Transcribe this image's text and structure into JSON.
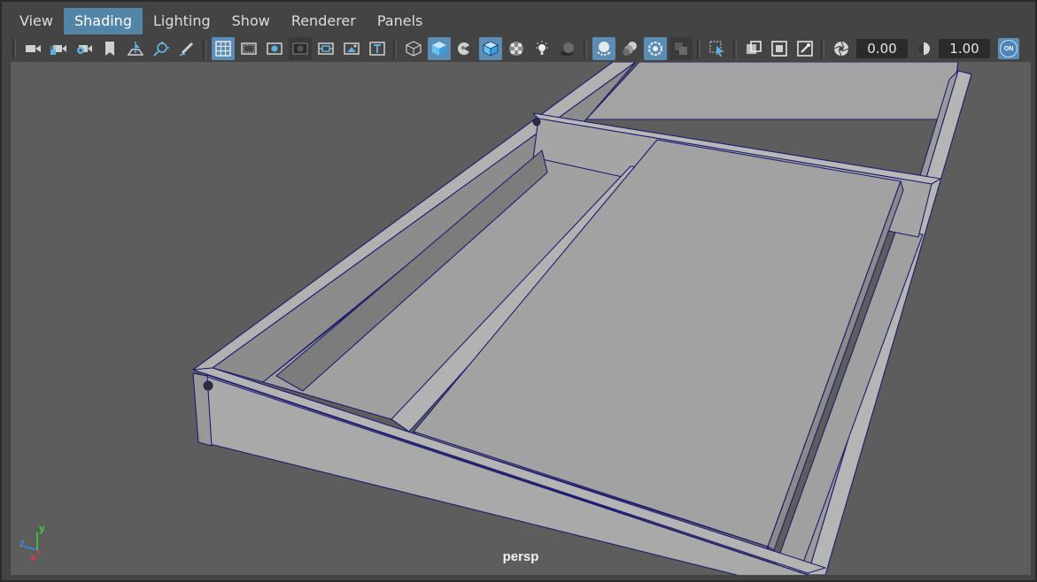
{
  "menu": {
    "items": [
      "View",
      "Shading",
      "Lighting",
      "Show",
      "Renderer",
      "Panels"
    ],
    "active": "Shading"
  },
  "toolbar": {
    "exposure_value": "0.00",
    "gamma_value": "1.00",
    "isolate_toggle_label": "ON"
  },
  "viewport": {
    "camera_label": "persp",
    "axis": {
      "x": "x",
      "y": "y",
      "z": "z"
    }
  },
  "colors": {
    "menu_active": "#5285a6",
    "toolbar_active": "#5b8db5",
    "viewport_bg": "#5d5d5d",
    "wireframe": "#1c1c6e",
    "axis_x": "#e83a3a",
    "axis_y": "#3ad43a",
    "axis_z": "#3a8ae8"
  }
}
